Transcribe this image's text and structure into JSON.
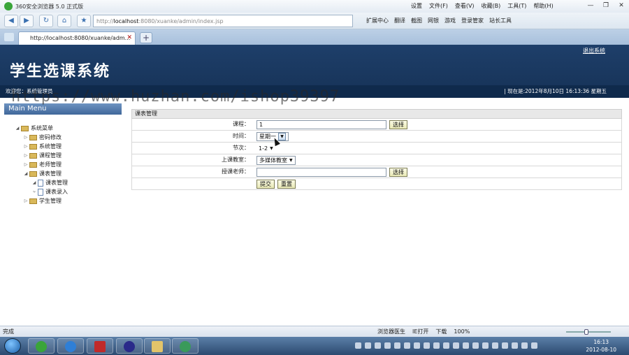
{
  "browser": {
    "app_title": "360安全浏览器 5.0 正式版",
    "menus": [
      "设置",
      "文件(F)",
      "查看(V)",
      "收藏(B)",
      "工具(T)",
      "帮助(H)"
    ],
    "window_controls": [
      "—",
      "❐",
      "✕"
    ],
    "url_prefix": "http://",
    "url_host": "localhost",
    "url_rest": ":8080/xuanke/admin/index.jsp",
    "toolbar_items": [
      "扩展中心",
      "翻译",
      "截图",
      "网银",
      "游戏",
      "登录管家",
      "站长工具"
    ],
    "tab_title": "http://localhost:8080/xuanke/adm...",
    "tab_close": "✕",
    "new_tab": "+"
  },
  "header": {
    "system_title": "学生选课系统",
    "logout": "退出系统",
    "welcome": "欢迎您：系统管理员",
    "now": "| 现在是:2012年8月10日  16:13:36 星期五"
  },
  "watermark": "https://www.huzhan.com/ishop39397",
  "sidebar": {
    "menu_title": "Main Menu",
    "root": "系统菜单",
    "items": [
      {
        "label": "密码修改"
      },
      {
        "label": "系统管理"
      },
      {
        "label": "课程管理"
      },
      {
        "label": "老师管理"
      },
      {
        "label": "课表管理"
      },
      {
        "label": "课表管理"
      },
      {
        "label": "课表录入"
      },
      {
        "label": "学生管理"
      }
    ]
  },
  "form": {
    "section_title": "课表管理",
    "course_label": "课程：",
    "course_value": "1",
    "select_button": "选择",
    "time_label": "时间：",
    "time_value": "星期一",
    "period_label": "节次：",
    "period_value": "1-2",
    "room_label": "上课教室：",
    "room_value": "多媒体教室",
    "teacher_label": "授课老师：",
    "teacher_value": "",
    "teacher_button": "选择",
    "submit_button": "提交",
    "reset_button": "重置"
  },
  "statusbar": {
    "done": "完成",
    "items": [
      "浏览器医生",
      "IE打开",
      "下载",
      "100%"
    ]
  },
  "taskbar": {
    "time": "16:13",
    "date": "2012-08-10"
  }
}
